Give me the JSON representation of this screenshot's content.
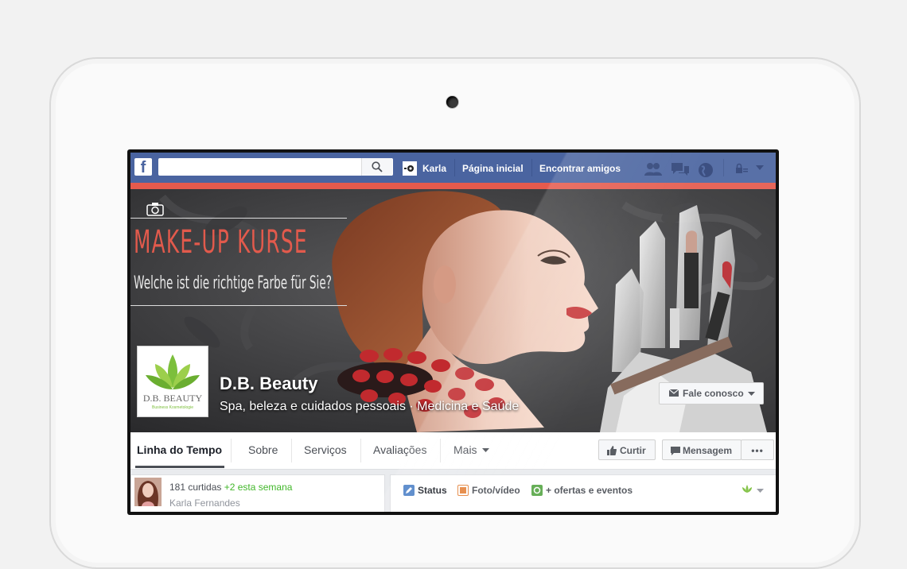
{
  "topbar": {
    "user_name": "Karla",
    "home_label": "Página inicial",
    "find_friends_label": "Encontrar amigos"
  },
  "cover": {
    "headline": "MAKE-UP KURSE",
    "subline": "Welche ist die richtige Farbe für Sie?",
    "logo_text": "D.B. BEAUTY",
    "logo_subtext": "Business Kosmetologie"
  },
  "page": {
    "name": "D.B. Beauty",
    "category": "Spa, beleza e cuidados pessoais · Medicina e Saúde",
    "contact_button": "Fale conosco"
  },
  "tabs": [
    {
      "label": "Linha do Tempo"
    },
    {
      "label": "Sobre"
    },
    {
      "label": "Serviços"
    },
    {
      "label": "Avaliações"
    },
    {
      "label": "Mais"
    }
  ],
  "actions": {
    "like": "Curtir",
    "message": "Mensagem",
    "more": "•••"
  },
  "likes_box": {
    "count_text": "181 curtidas",
    "delta_text": "+2 esta semana",
    "friend_name": "Karla Fernandes"
  },
  "composer": {
    "status": "Status",
    "photo_video": "Foto/vídeo",
    "offers_events": "+ ofertas e eventos"
  },
  "colors": {
    "facebook_blue": "#4a64a0",
    "accent_red": "#e55a4d",
    "green_delta": "#42b72a"
  }
}
